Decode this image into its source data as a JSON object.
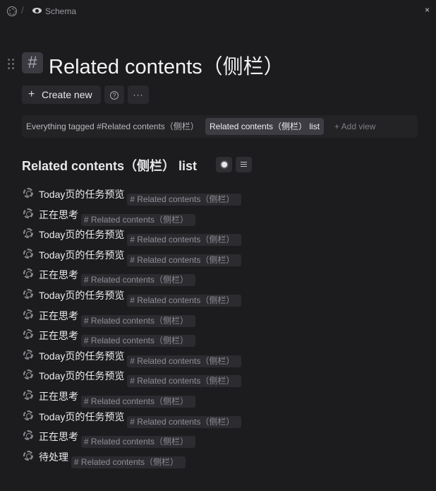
{
  "breadcrumb": {
    "separator": "/",
    "page": "Schema",
    "page_icon": "eye-icon",
    "logo_icon": "logo-icon",
    "close_glyph": "×"
  },
  "page": {
    "hash": "#",
    "title": "Related contents（侧栏）"
  },
  "toolbar": {
    "create_label": "Create new",
    "plus_glyph": "+",
    "help_glyph": "?",
    "more_glyph": "···"
  },
  "views": {
    "tabs": [
      {
        "label": "Everything tagged #Related contents（侧栏）",
        "active": false
      },
      {
        "label": "Related contents（侧栏） list",
        "active": true
      }
    ],
    "add_label": "+  Add view"
  },
  "list": {
    "title": "Related contents（侧栏） list",
    "items": [
      {
        "title": "Today页的任务预览",
        "tag": "# Related contents（侧栏）"
      },
      {
        "title": "正在思考",
        "tag": "# Related contents（侧栏）"
      },
      {
        "title": "Today页的任务预览",
        "tag": "# Related contents（侧栏）"
      },
      {
        "title": "Today页的任务预览",
        "tag": "# Related contents（侧栏）"
      },
      {
        "title": "正在思考",
        "tag": "# Related contents（侧栏）"
      },
      {
        "title": "Today页的任务预览",
        "tag": "# Related contents（侧栏）"
      },
      {
        "title": "正在思考",
        "tag": "# Related contents（侧栏）"
      },
      {
        "title": "正在思考",
        "tag": "# Related contents（侧栏）"
      },
      {
        "title": "Today页的任务预览",
        "tag": "# Related contents（侧栏）"
      },
      {
        "title": "Today页的任务预览",
        "tag": "# Related contents（侧栏）"
      },
      {
        "title": "正在思考",
        "tag": "# Related contents（侧栏）"
      },
      {
        "title": "Today页的任务预览",
        "tag": "# Related contents（侧栏）"
      },
      {
        "title": "正在思考",
        "tag": "# Related contents（侧栏）"
      },
      {
        "title": "待处理",
        "tag": "# Related contents（侧栏）"
      }
    ]
  },
  "colors": {
    "background": "#1c1c1e",
    "surface": "#2a2a2e",
    "active_tab": "#3c3c42",
    "text": "#e8e8ea",
    "muted": "#8e8e96"
  }
}
